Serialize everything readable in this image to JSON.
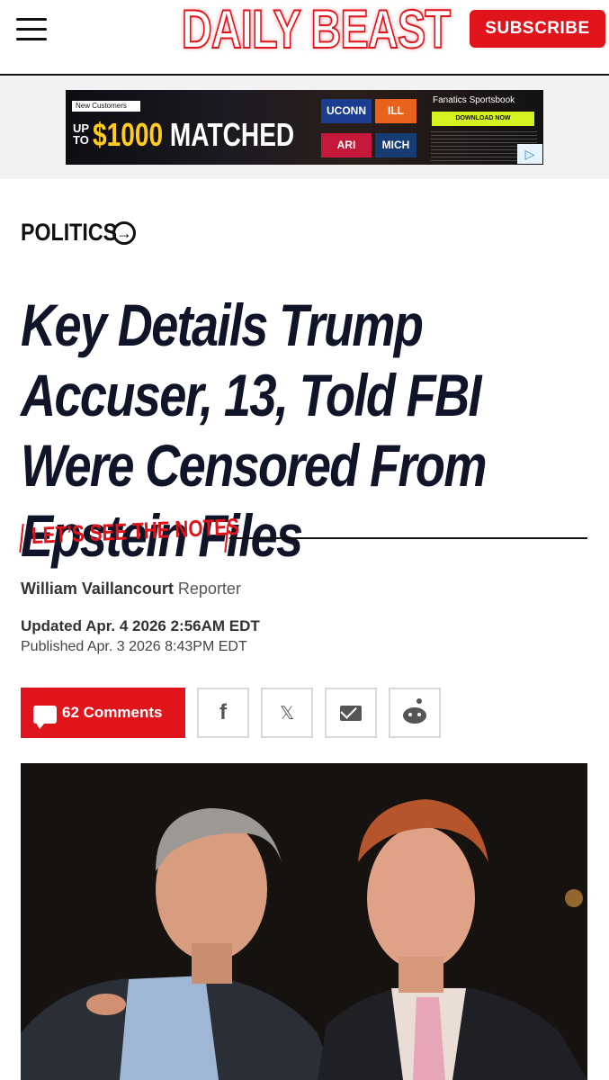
{
  "header": {
    "logo": "DAILY BEAST",
    "subscribe_label": "SUBSCRIBE"
  },
  "ad": {
    "new_customers": "New Customers",
    "up_to": "UP TO",
    "amount": "$1000",
    "matched": "MATCHED",
    "teams": [
      "UCONN",
      "ILL",
      "ARI",
      "MICH"
    ],
    "brand": "Fanatics Sportsbook",
    "cta": "DOWNLOAD NOW"
  },
  "article": {
    "section": "POLITICS",
    "headline": "Key Details Trump Accuser, 13, Told FBI Were Censored From Epstein Files",
    "rubric": "LET’S SEE THE NOTES",
    "author": "William Vaillancourt",
    "author_role": "Reporter",
    "updated": "Updated Apr. 4 2026 2:56AM EDT",
    "published": "Published Apr. 3 2026 8:43PM EDT"
  },
  "share": {
    "comments_label": "62 Comments",
    "facebook": "f",
    "x": "𝕏"
  },
  "colors": {
    "brand_red": "#e0141b",
    "headline_navy": "#0f1428"
  }
}
